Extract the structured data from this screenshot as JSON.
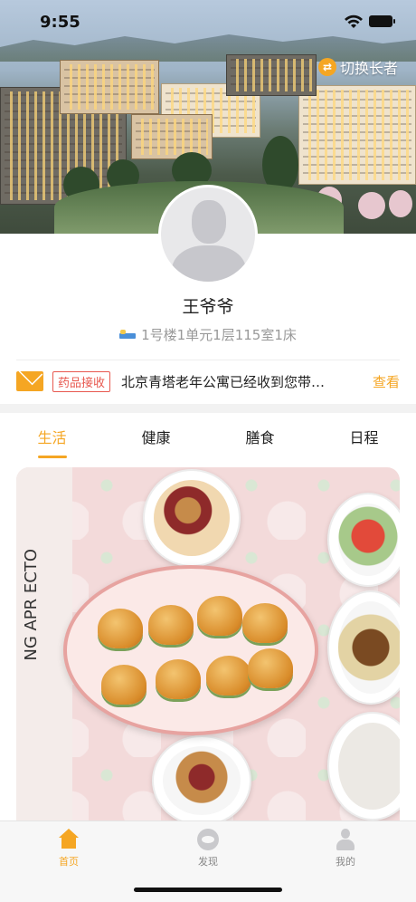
{
  "status_bar": {
    "time": "9:55"
  },
  "header": {
    "switch_label": "切换长者"
  },
  "profile": {
    "name": "王爷爷",
    "room": "1号楼1单元1层115室1床"
  },
  "notice": {
    "badge": "药品接收",
    "text": "北京青塔老年公寓已经收到您带…",
    "action": "查看"
  },
  "tabs": [
    {
      "label": "生活",
      "active": true
    },
    {
      "label": "健康",
      "active": false
    },
    {
      "label": "膳食",
      "active": false
    },
    {
      "label": "日程",
      "active": false
    }
  ],
  "photo": {
    "cloth_text": "NG APR ECTO"
  },
  "tabbar": [
    {
      "label": "首页",
      "icon": "home-icon",
      "active": true
    },
    {
      "label": "发现",
      "icon": "discover-icon",
      "active": false
    },
    {
      "label": "我的",
      "icon": "profile-icon",
      "active": false
    }
  ],
  "colors": {
    "accent": "#f5a623",
    "badge_red": "#e8584f"
  }
}
